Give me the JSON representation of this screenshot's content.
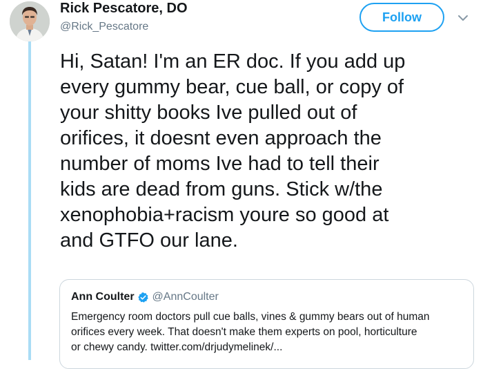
{
  "author": {
    "name": "Rick Pescatore, DO",
    "handle": "@Rick_Pescatore"
  },
  "follow_button": {
    "label": "Follow"
  },
  "tweet": {
    "lines": [
      "Hi, Satan! I'm an ER doc. If you add up",
      "every gummy bear, cue ball, or copy of",
      "your shitty books Ive pulled out of",
      "orifices, it doesnt even approach the",
      "number of moms Ive had to tell their",
      "kids are dead from guns. Stick w/the",
      "xenophobia+racism youre so good at",
      "and GTFO our lane."
    ]
  },
  "quoted_tweet": {
    "name": "Ann Coulter",
    "handle": "@AnnCoulter",
    "lines": [
      "Emergency room doctors pull cue balls, vines & gummy bears out of human",
      "orifices every week.  That doesn't make them experts on pool, horticulture",
      "or chewy candy. twitter.com/drjudymelinek/..."
    ]
  },
  "colors": {
    "accent": "#1da1f2",
    "thread_line": "#aadcf5",
    "secondary_text": "#657786"
  },
  "icons": {
    "menu": "chevron-down-icon",
    "verified": "verified-badge-icon"
  }
}
